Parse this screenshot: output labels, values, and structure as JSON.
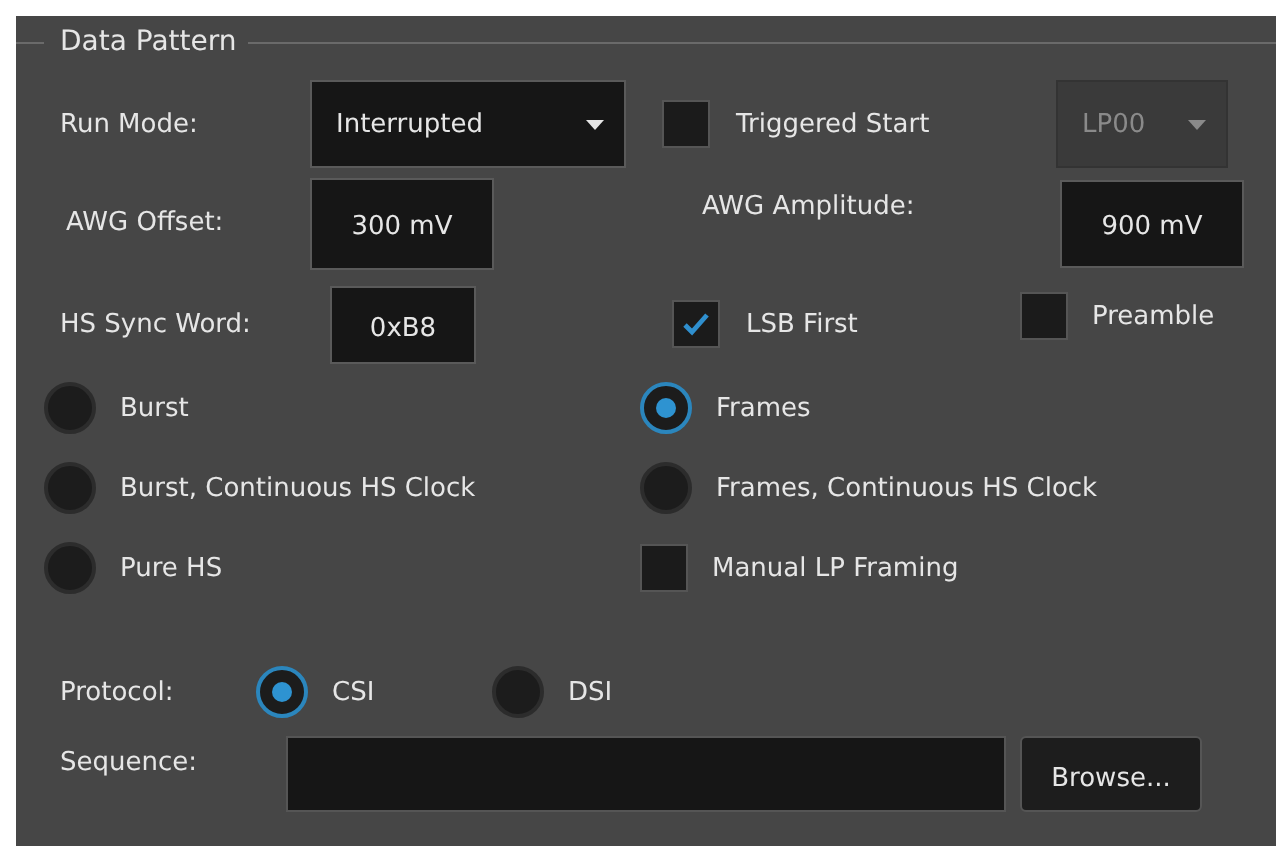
{
  "group": {
    "title": "Data Pattern"
  },
  "run_mode": {
    "label": "Run Mode:",
    "value": "Interrupted"
  },
  "triggered_start": {
    "label": "Triggered Start",
    "checked": false
  },
  "lp_state": {
    "value": "LP00",
    "disabled": true
  },
  "awg_offset": {
    "label": "AWG Offset:",
    "value": "300 mV"
  },
  "awg_amplitude": {
    "label": "AWG Amplitude:",
    "value": "900 mV"
  },
  "hs_sync_word": {
    "label": "HS Sync Word:",
    "value": "0xB8"
  },
  "lsb_first": {
    "label": "LSB First",
    "checked": true
  },
  "preamble": {
    "label": "Preamble",
    "checked": false
  },
  "options": [
    {
      "kind": "radio",
      "label": "Burst",
      "selected": false
    },
    {
      "kind": "radio",
      "label": "Frames",
      "selected": true
    },
    {
      "kind": "radio",
      "label": "Burst, Continuous HS Clock",
      "selected": false
    },
    {
      "kind": "radio",
      "label": "Frames, Continuous HS Clock",
      "selected": false
    },
    {
      "kind": "radio",
      "label": "Pure HS",
      "selected": false
    },
    {
      "kind": "checkbox",
      "label": "Manual LP Framing",
      "checked": false
    }
  ],
  "protocol": {
    "label": "Protocol:",
    "options": [
      {
        "label": "CSI",
        "selected": true
      },
      {
        "label": "DSI",
        "selected": false
      }
    ]
  },
  "sequence": {
    "label": "Sequence:"
  },
  "browse_button": "Browse..."
}
